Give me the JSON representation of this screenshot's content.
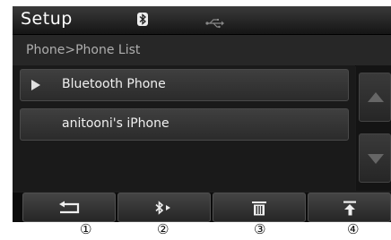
{
  "header": {
    "title": "Setup",
    "status_icons": [
      "bluetooth-icon",
      "usb-icon"
    ]
  },
  "breadcrumb": "Phone>Phone List",
  "phone_list": [
    {
      "label": "Bluetooth Phone",
      "icon": "play-icon",
      "selected": true
    },
    {
      "label": "anitooni's iPhone",
      "selected": false
    }
  ],
  "scroll": {
    "up_icon": "scroll-up-icon",
    "down_icon": "scroll-down-icon"
  },
  "toolbar": [
    {
      "icon": "back-icon"
    },
    {
      "icon": "bluetooth-connect-icon"
    },
    {
      "icon": "delete-icon"
    },
    {
      "icon": "move-top-icon"
    }
  ],
  "callouts": [
    "①",
    "②",
    "③",
    "④"
  ],
  "colors": {
    "background": "#1c1c1c",
    "text": "#f0f0f0",
    "breadcrumb_text": "#aeaeae"
  }
}
